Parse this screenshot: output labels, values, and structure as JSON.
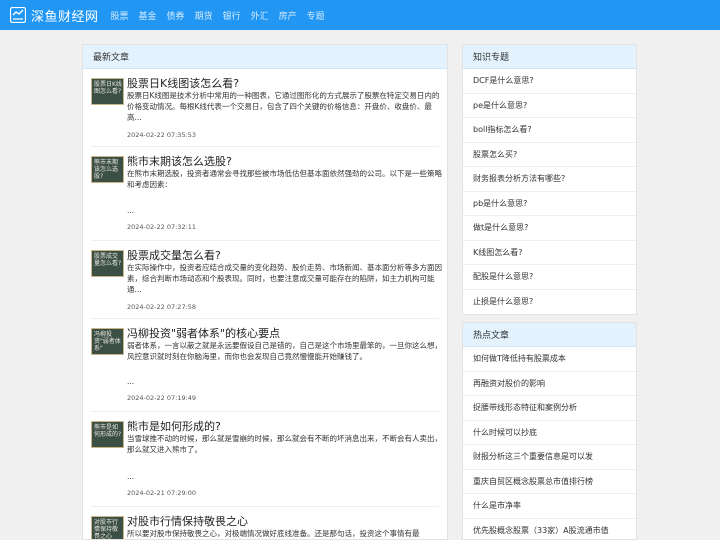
{
  "site": {
    "name": "深鱼财经网",
    "nav": [
      "股票",
      "基金",
      "债券",
      "期货",
      "银行",
      "外汇",
      "房产",
      "专题"
    ]
  },
  "latest": {
    "heading": "最新文章",
    "articles": [
      {
        "thumb": "股票日K线图怎么看?",
        "title": "股票日K线图该怎么看?",
        "summary": "股票日K线图是技术分析中常用的一种图表，它通过图形化的方式展示了股票在特定交易日内的价格变动情况。每根K线代表一个交易日，包含了四个关键的价格信息：开盘价、收盘价、最高...",
        "dots": "",
        "date": "2024-02-22 07:35:53"
      },
      {
        "thumb": "熊市末期该怎么选股?",
        "title": "熊市末期该怎么选股?",
        "summary": "在熊市末期选股，投资者通常会寻找那些被市场低估但基本面依然强劲的公司。以下是一些策略和考虑因素：",
        "dots": "...",
        "date": "2024-02-22 07:32:11"
      },
      {
        "thumb": "股票成交量怎么看?",
        "title": "股票成交量怎么看?",
        "summary": "在实际操作中，投资者应结合成交量的变化趋势、股价走势、市场新闻、基本面分析等多方面因素，综合判断市场动态和个股表现。同时，也要注意成交量可能存在的陷阱，如主力机构可能通...",
        "dots": "",
        "date": "2024-02-22 07:27:58"
      },
      {
        "thumb": "冯柳投资\"弱者体系\"",
        "title": "冯柳投资\"弱者体系\"的核心要点",
        "summary": "弱者体系，一言以蔽之就是永远要假设自己是错的，自己是这个市场里最笨的，一旦你这么想，风控意识就时刻在你脑海里，而你也会发现自己竟然慢慢能开始赚钱了。",
        "dots": "...",
        "date": "2024-02-22 07:19:49"
      },
      {
        "thumb": "熊市是如何形成的?",
        "title": "熊市是如何形成的?",
        "summary": "当雪球推不动的时候，那么就是雪崩的时候，那么就会有不断的坏消息出来，不断会有人卖出，那么就又进入熊市了。",
        "dots": "...",
        "date": "2024-02-21 07:29:00"
      },
      {
        "thumb": "对股市行情保持敬畏之心",
        "title": "对股市行情保持敬畏之心",
        "summary": "所以要对股市保持敬畏之心，对极端情况做好底线准备。还是那句话，投资这个事情有最",
        "dots": "",
        "date": ""
      }
    ]
  },
  "knowledge": {
    "heading": "知识专题",
    "items": [
      "DCF是什么意思?",
      "pe是什么意思?",
      "boll指标怎么看?",
      "股票怎么买?",
      "财务报表分析方法有哪些?",
      "pb是什么意思?",
      "做t是什么意思?",
      "K线图怎么看?",
      "配股是什么意思?",
      "止损是什么意思?"
    ]
  },
  "hot": {
    "heading": "热点文章",
    "items": [
      "如何做T降低持有股票成本",
      "再融资对股价的影响",
      "捉腰带线形态特征和案例分析",
      "什么时候可以抄底",
      "财报分析这三个重要信息是可以发",
      "重庆自贸区概念股票总市值排行榜",
      "什么是市净率",
      "优先股概念股票（33家）A股流通市值"
    ]
  },
  "colors": {
    "topbar": "#2196f3",
    "box_head": "#e3f2fd"
  }
}
